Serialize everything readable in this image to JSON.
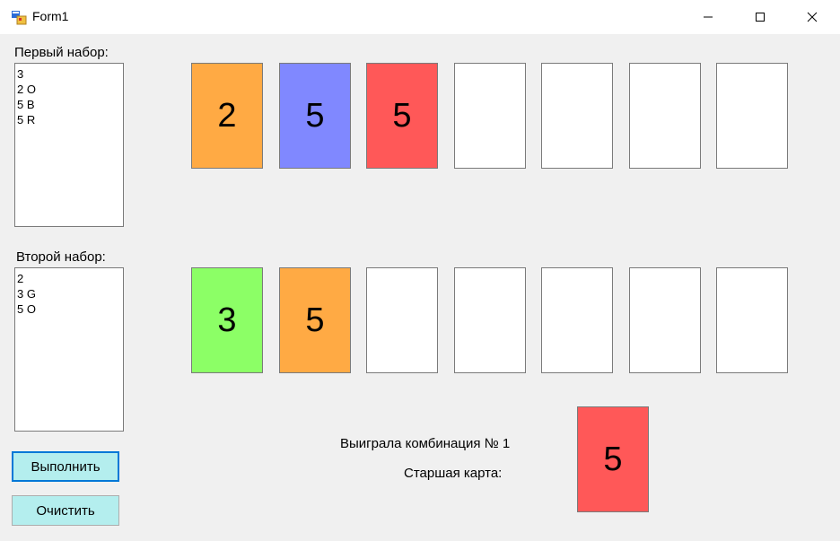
{
  "window": {
    "title": "Form1"
  },
  "first_set": {
    "label": "Первый набор:",
    "lines": [
      "3",
      "2 O",
      "5 B",
      "5 R"
    ]
  },
  "second_set": {
    "label": "Второй набор:",
    "lines": [
      "2",
      "3 G",
      "5 O"
    ]
  },
  "buttons": {
    "execute": "Выполнить",
    "clear": "Очистить"
  },
  "row1_cards": [
    {
      "value": "2",
      "color": "#ffaa44"
    },
    {
      "value": "5",
      "color": "#8088ff"
    },
    {
      "value": "5",
      "color": "#ff5858"
    },
    {
      "value": "",
      "color": "#ffffff"
    },
    {
      "value": "",
      "color": "#ffffff"
    },
    {
      "value": "",
      "color": "#ffffff"
    },
    {
      "value": "",
      "color": "#ffffff"
    }
  ],
  "row2_cards": [
    {
      "value": "3",
      "color": "#8cff66"
    },
    {
      "value": "5",
      "color": "#ffaa44"
    },
    {
      "value": "",
      "color": "#ffffff"
    },
    {
      "value": "",
      "color": "#ffffff"
    },
    {
      "value": "",
      "color": "#ffffff"
    },
    {
      "value": "",
      "color": "#ffffff"
    },
    {
      "value": "",
      "color": "#ffffff"
    }
  ],
  "result": {
    "winner_text": "Выиграла комбинация № 1",
    "high_card_label": "Старшая карта:",
    "high_card": {
      "value": "5",
      "color": "#ff5858"
    }
  }
}
